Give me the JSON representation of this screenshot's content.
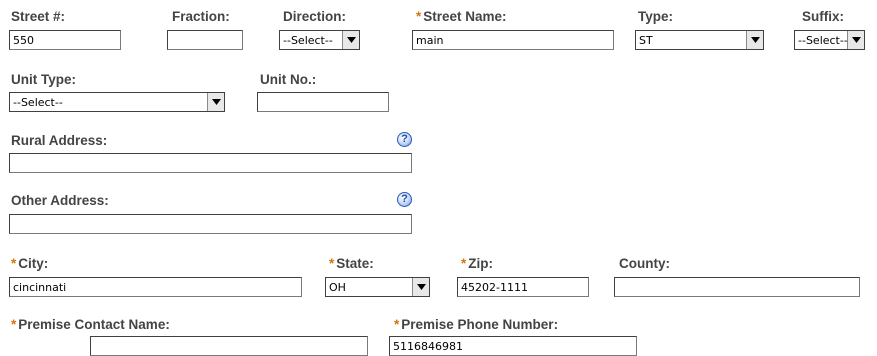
{
  "row1": {
    "street_number": {
      "label": "Street #:",
      "value": "550"
    },
    "fraction": {
      "label": "Fraction:",
      "value": ""
    },
    "direction": {
      "label": "Direction:",
      "value": "--Select--"
    },
    "street_name": {
      "label": "Street Name:",
      "value": "main",
      "required": true
    },
    "type": {
      "label": "Type:",
      "value": "ST"
    },
    "suffix": {
      "label": "Suffix:",
      "value": "--Select--"
    }
  },
  "row2": {
    "unit_type": {
      "label": "Unit Type:",
      "value": "--Select--"
    },
    "unit_no": {
      "label": "Unit No.:",
      "value": ""
    }
  },
  "rural_address": {
    "label": "Rural Address:",
    "value": "",
    "help": "?"
  },
  "other_address": {
    "label": "Other Address:",
    "value": "",
    "help": "?"
  },
  "row5": {
    "city": {
      "label": "City:",
      "value": "cincinnati",
      "required": true
    },
    "state": {
      "label": "State:",
      "value": "OH",
      "required": true
    },
    "zip": {
      "label": "Zip:",
      "value": "45202-1111",
      "required": true
    },
    "county": {
      "label": "County:",
      "value": ""
    }
  },
  "row6": {
    "premise_contact_name": {
      "label": "Premise Contact Name:",
      "value": "",
      "required": true
    },
    "premise_phone_number": {
      "label": "Premise Phone Number:",
      "value": "5116846981",
      "required": true
    }
  },
  "required_marker": "*",
  "colors": {
    "label": "#444444",
    "required_marker": "#d4740c",
    "help_icon": "#2c5ab0"
  }
}
